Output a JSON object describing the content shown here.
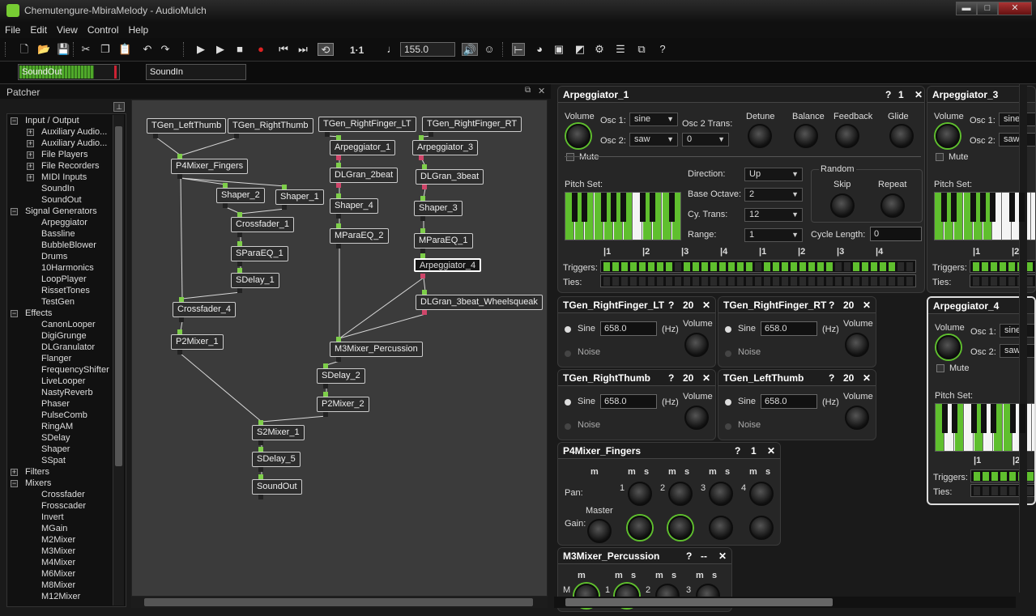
{
  "window": {
    "title": "Chemutengure-MbiraMelody - AudioMulch",
    "min": "▬",
    "max": "□",
    "close": "✕"
  },
  "menu": [
    "File",
    "Edit",
    "View",
    "Control",
    "Help"
  ],
  "toolbar": {
    "position": "1·1",
    "tempo": "155.0"
  },
  "strip": {
    "out": "SoundOut",
    "in": "SoundIn"
  },
  "patcher": {
    "title": "Patcher"
  },
  "tree": [
    {
      "label": "Input / Output",
      "level": 0,
      "ex": "−"
    },
    {
      "label": "Auxiliary Audio...",
      "level": 1,
      "ex": "+"
    },
    {
      "label": "Auxiliary Audio...",
      "level": 1,
      "ex": "+"
    },
    {
      "label": "File Players",
      "level": 1,
      "ex": "+"
    },
    {
      "label": "File Recorders",
      "level": 1,
      "ex": "+"
    },
    {
      "label": "MIDI Inputs",
      "level": 1,
      "ex": "+"
    },
    {
      "label": "SoundIn",
      "level": 2
    },
    {
      "label": "SoundOut",
      "level": 2
    },
    {
      "label": "Signal Generators",
      "level": 0,
      "ex": "−"
    },
    {
      "label": "Arpeggiator",
      "level": 2
    },
    {
      "label": "Bassline",
      "level": 2
    },
    {
      "label": "BubbleBlower",
      "level": 2
    },
    {
      "label": "Drums",
      "level": 2
    },
    {
      "label": "10Harmonics",
      "level": 2
    },
    {
      "label": "LoopPlayer",
      "level": 2
    },
    {
      "label": "RissetTones",
      "level": 2
    },
    {
      "label": "TestGen",
      "level": 2
    },
    {
      "label": "Effects",
      "level": 0,
      "ex": "−"
    },
    {
      "label": "CanonLooper",
      "level": 2
    },
    {
      "label": "DigiGrunge",
      "level": 2
    },
    {
      "label": "DLGranulator",
      "level": 2
    },
    {
      "label": "Flanger",
      "level": 2
    },
    {
      "label": "FrequencyShifter",
      "level": 2
    },
    {
      "label": "LiveLooper",
      "level": 2
    },
    {
      "label": "NastyReverb",
      "level": 2
    },
    {
      "label": "Phaser",
      "level": 2
    },
    {
      "label": "PulseComb",
      "level": 2
    },
    {
      "label": "RingAM",
      "level": 2
    },
    {
      "label": "SDelay",
      "level": 2
    },
    {
      "label": "Shaper",
      "level": 2
    },
    {
      "label": "SSpat",
      "level": 2
    },
    {
      "label": "Filters",
      "level": 0,
      "ex": "+"
    },
    {
      "label": "Mixers",
      "level": 0,
      "ex": "−"
    },
    {
      "label": "Crossfader",
      "level": 2
    },
    {
      "label": "Frosscader",
      "level": 2
    },
    {
      "label": "Invert",
      "level": 2
    },
    {
      "label": "MGain",
      "level": 2
    },
    {
      "label": "M2Mixer",
      "level": 2
    },
    {
      "label": "M3Mixer",
      "level": 2
    },
    {
      "label": "M4Mixer",
      "level": 2
    },
    {
      "label": "M6Mixer",
      "level": 2
    },
    {
      "label": "M8Mixer",
      "level": 2
    },
    {
      "label": "M12Mixer",
      "level": 2
    }
  ],
  "nodes": [
    {
      "label": "TGen_LeftThumb"
    },
    {
      "label": "TGen_RightThumb"
    },
    {
      "label": "TGen_RightFinger_LT"
    },
    {
      "label": "TGen_RightFinger_RT"
    },
    {
      "label": "Arpeggiator_1"
    },
    {
      "label": "Arpeggiator_3"
    },
    {
      "label": "P4Mixer_Fingers"
    },
    {
      "label": "DLGran_2beat"
    },
    {
      "label": "DLGran_3beat"
    },
    {
      "label": "Shaper_2"
    },
    {
      "label": "Shaper_1"
    },
    {
      "label": "Shaper_4"
    },
    {
      "label": "Shaper_3"
    },
    {
      "label": "Crossfader_1"
    },
    {
      "label": "MParaEQ_2"
    },
    {
      "label": "MParaEQ_1"
    },
    {
      "label": "SParaEQ_1"
    },
    {
      "label": "Arpeggiator_4"
    },
    {
      "label": "SDelay_1"
    },
    {
      "label": "DLGran_3beat_Wheelsqueak"
    },
    {
      "label": "Crossfader_4"
    },
    {
      "label": "P2Mixer_1"
    },
    {
      "label": "M3Mixer_Percussion"
    },
    {
      "label": "SDelay_2"
    },
    {
      "label": "P2Mixer_2"
    },
    {
      "label": "S2Mixer_1"
    },
    {
      "label": "SDelay_5"
    },
    {
      "label": "SoundOut"
    }
  ],
  "arp1": {
    "title": "Arpeggiator_1",
    "q": "?",
    "n": "1",
    "x": "✕",
    "volume": "Volume",
    "osc1": "Osc 1:",
    "osc1v": "sine",
    "osc2": "Osc 2:",
    "osc2v": "saw",
    "osc2trans": "Osc 2 Trans:",
    "osc2transv": "0",
    "detune": "Detune",
    "balance": "Balance",
    "feedback": "Feedback",
    "glide": "Glide",
    "mute": "Mute",
    "pitchset": "Pitch Set:",
    "direction": "Direction:",
    "directionv": "Up",
    "baseoct": "Base Octave:",
    "baseoctv": "2",
    "cytrans": "Cy. Trans:",
    "cytransv": "12",
    "range": "Range:",
    "rangev": "1",
    "random": "Random",
    "skip": "Skip",
    "repeat": "Repeat",
    "cyclelen": "Cycle Length:",
    "cyclelenv": "0",
    "beats": [
      "|1",
      "|2",
      "|3",
      "|4",
      "|1",
      "|2",
      "|3",
      "|4"
    ],
    "triggers": "Triggers:",
    "ties": "Ties:"
  },
  "arp3": {
    "title": "Arpeggiator_3",
    "volume": "Volume",
    "osc1": "Osc 1:",
    "osc1v": "sine",
    "osc2": "Osc 2:",
    "osc2v": "saw",
    "mute": "Mute",
    "pitchset": "Pitch Set:",
    "beat1": "|1",
    "beat2": "|2",
    "triggers": "Triggers:",
    "ties": "Ties:"
  },
  "arp4": {
    "title": "Arpeggiator_4",
    "volume": "Volume",
    "osc1": "Osc 1:",
    "osc1v": "sine",
    "osc2": "Osc 2:",
    "osc2v": "saw",
    "mute": "Mute",
    "pitchset": "Pitch Set:",
    "beat1": "|1",
    "beat2": "|2",
    "triggers": "Triggers:",
    "ties": "Ties:"
  },
  "tgens": [
    {
      "title": "TGen_RightFinger_LT",
      "q": "?",
      "n": "20",
      "x": "✕",
      "sine": "Sine",
      "freq": "658.0",
      "hz": "(Hz)",
      "noise": "Noise",
      "volume": "Volume"
    },
    {
      "title": "TGen_RightFinger_RT",
      "q": "?",
      "n": "20",
      "x": "✕",
      "sine": "Sine",
      "freq": "658.0",
      "hz": "(Hz)",
      "noise": "Noise",
      "volume": "Volume"
    },
    {
      "title": "TGen_RightThumb",
      "q": "?",
      "n": "20",
      "x": "✕",
      "sine": "Sine",
      "freq": "658.0",
      "hz": "(Hz)",
      "noise": "Noise",
      "volume": "Volume"
    },
    {
      "title": "TGen_LeftThumb",
      "q": "?",
      "n": "20",
      "x": "✕",
      "sine": "Sine",
      "freq": "658.0",
      "hz": "(Hz)",
      "noise": "Noise",
      "volume": "Volume"
    }
  ],
  "p4": {
    "title": "P4Mixer_Fingers",
    "q": "?",
    "n": "1",
    "x": "✕",
    "m": "m",
    "s": "s",
    "pan": "Pan:",
    "gain": "Gain:",
    "master": "Master",
    "ch": [
      "1",
      "2",
      "3",
      "4"
    ]
  },
  "m3": {
    "title": "M3Mixer_Percussion",
    "q": "?",
    "n": "--",
    "x": "✕",
    "m": "m",
    "s": "s",
    "M": "M",
    "ch": [
      "1",
      "2",
      "3"
    ]
  },
  "colors": {
    "accent": "#5fbf2e",
    "port_in": "#7ecf4a",
    "port_out": "#d0466a"
  }
}
